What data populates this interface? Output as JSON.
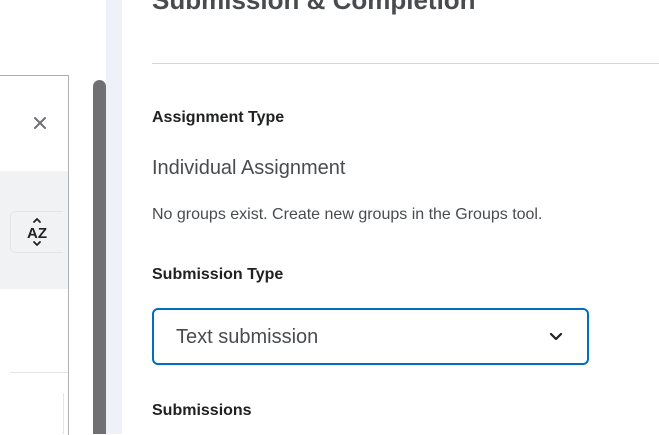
{
  "left_panel": {
    "close_icon": "close-icon",
    "sort_icon": "sort-az-icon",
    "sort_label": "AZ"
  },
  "section": {
    "title": "Submission & Completion"
  },
  "assignment_type": {
    "label": "Assignment Type",
    "value": "Individual Assignment",
    "helper": "No groups exist. Create new groups in the Groups tool."
  },
  "submission_type": {
    "label": "Submission Type",
    "selected": "Text submission",
    "icon": "chevron-down-icon"
  },
  "submissions": {
    "label": "Submissions"
  },
  "colors": {
    "accent": "#006fbf",
    "scrollbar": "#6e7073",
    "gutter": "#eef1f7",
    "panel_band": "#f1f2f4"
  }
}
